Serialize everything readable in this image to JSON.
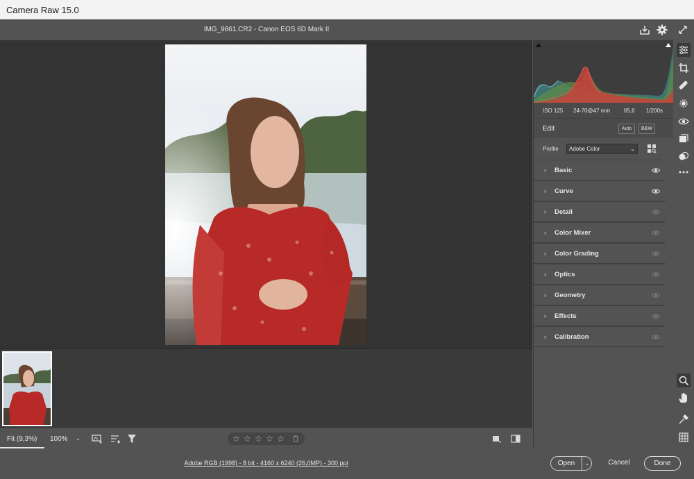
{
  "window": {
    "title": "Camera Raw 15.0"
  },
  "header": {
    "file_info": "IMG_9861.CR2  -  Canon EOS 6D Mark II"
  },
  "histogram": {
    "meta": {
      "iso": "ISO 125",
      "lens": "24-70@47 mm",
      "aperture": "f/5,6",
      "shutter": "1/200s"
    }
  },
  "edit": {
    "title": "Edit",
    "auto_label": "Auto",
    "bw_label": "B&W",
    "profile_label": "Profile",
    "profile_value": "Adobe Color"
  },
  "sections": [
    {
      "label": "Basic",
      "eye_active": true
    },
    {
      "label": "Curve",
      "eye_active": true
    },
    {
      "label": "Detail",
      "eye_active": false
    },
    {
      "label": "Color Mixer",
      "eye_active": false
    },
    {
      "label": "Color Grading",
      "eye_active": false
    },
    {
      "label": "Optics",
      "eye_active": false
    },
    {
      "label": "Geometry",
      "eye_active": false
    },
    {
      "label": "Effects",
      "eye_active": false
    },
    {
      "label": "Calibration",
      "eye_active": false
    }
  ],
  "bottombar": {
    "fit_label": "Fit (9,3%)",
    "zoom_label": "100%",
    "stars": [
      "☆",
      "☆",
      "☆",
      "☆",
      "☆"
    ]
  },
  "statusbar": {
    "workflow": "Adobe RGB (1998) - 8 bit - 4160 x 6240 (26,0MP) - 300 ppi",
    "open_label": "Open",
    "cancel_label": "Cancel",
    "done_label": "Done"
  },
  "colors": {
    "accent_red": "#c0302a",
    "panel_bg": "#535353",
    "canvas_bg": "#333333"
  }
}
